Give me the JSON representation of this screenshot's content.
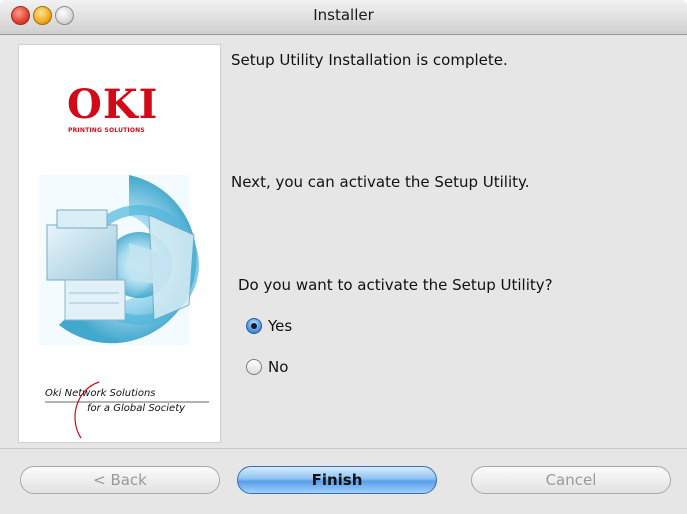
{
  "window": {
    "title": "Installer"
  },
  "sidepanel": {
    "logo_text": "OKI",
    "logo_subtext": "PRINTING SOLUTIONS",
    "tagline_line1": "Oki Network Solutions",
    "tagline_line2": "for a Global Society",
    "brand_color": "#d20a17"
  },
  "content": {
    "message_complete": "Setup Utility Installation is complete.",
    "message_next": "Next, you can activate the Setup Utility.",
    "question": "Do you want to activate the Setup Utility?",
    "options": [
      {
        "label": "Yes",
        "selected": true
      },
      {
        "label": "No",
        "selected": false
      }
    ]
  },
  "buttons": {
    "back": "< Back",
    "finish": "Finish",
    "cancel": "Cancel"
  }
}
